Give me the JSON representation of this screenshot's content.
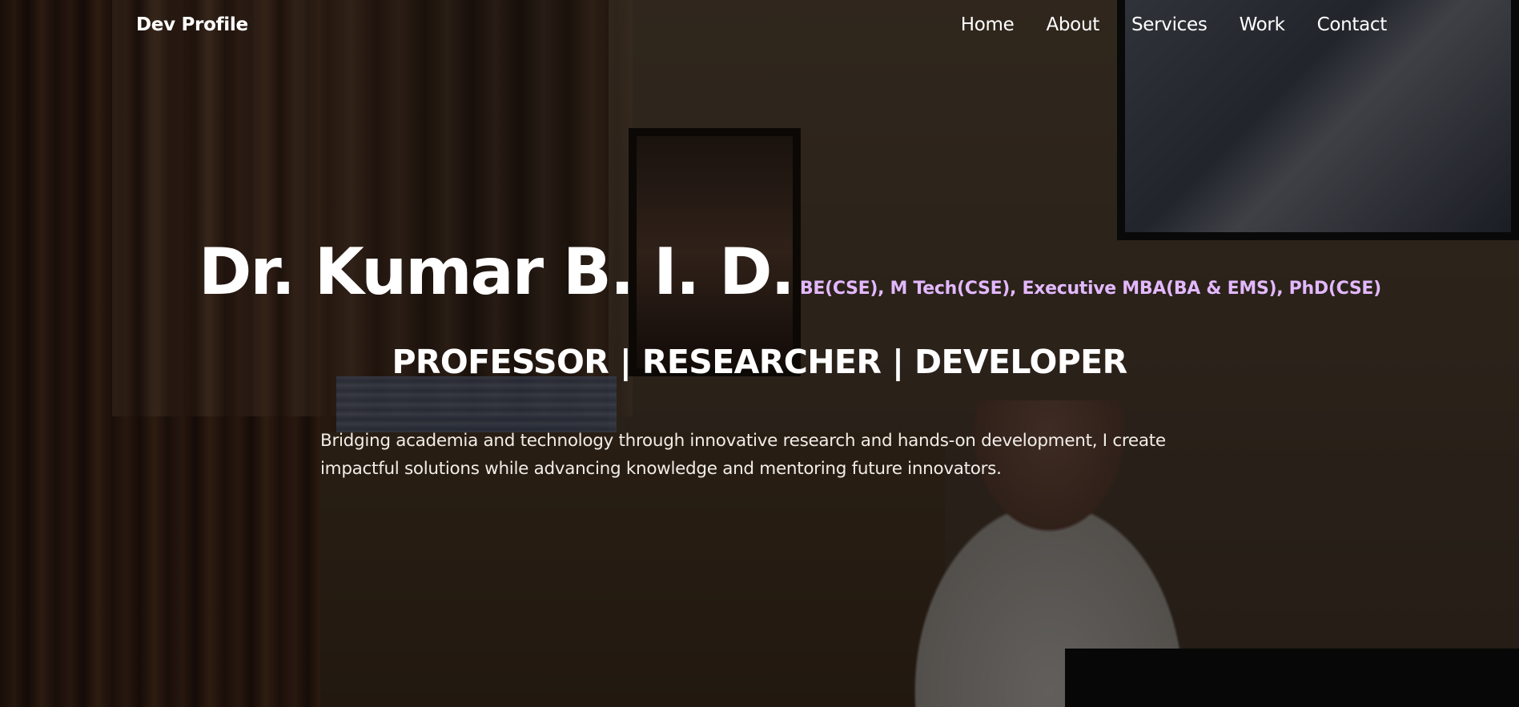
{
  "nav": {
    "brand": "Dev Profile",
    "links": [
      "Home",
      "About",
      "Services",
      "Work",
      "Contact"
    ]
  },
  "hero": {
    "name": "Dr. Kumar B. I. D.",
    "degrees": "BE(CSE), M Tech(CSE), Executive MBA(BA & EMS), PhD(CSE)",
    "roles": "PROFESSOR | RESEARCHER | DEVELOPER",
    "tagline": "Bridging academia and technology through innovative research and hands-on development, I create impactful solutions while advancing knowledge and mentoring future innovators."
  },
  "colors": {
    "accent": "#e3b8ff",
    "text": "#ffffff",
    "overlay": "rgba(0,0,0,0.55)"
  }
}
